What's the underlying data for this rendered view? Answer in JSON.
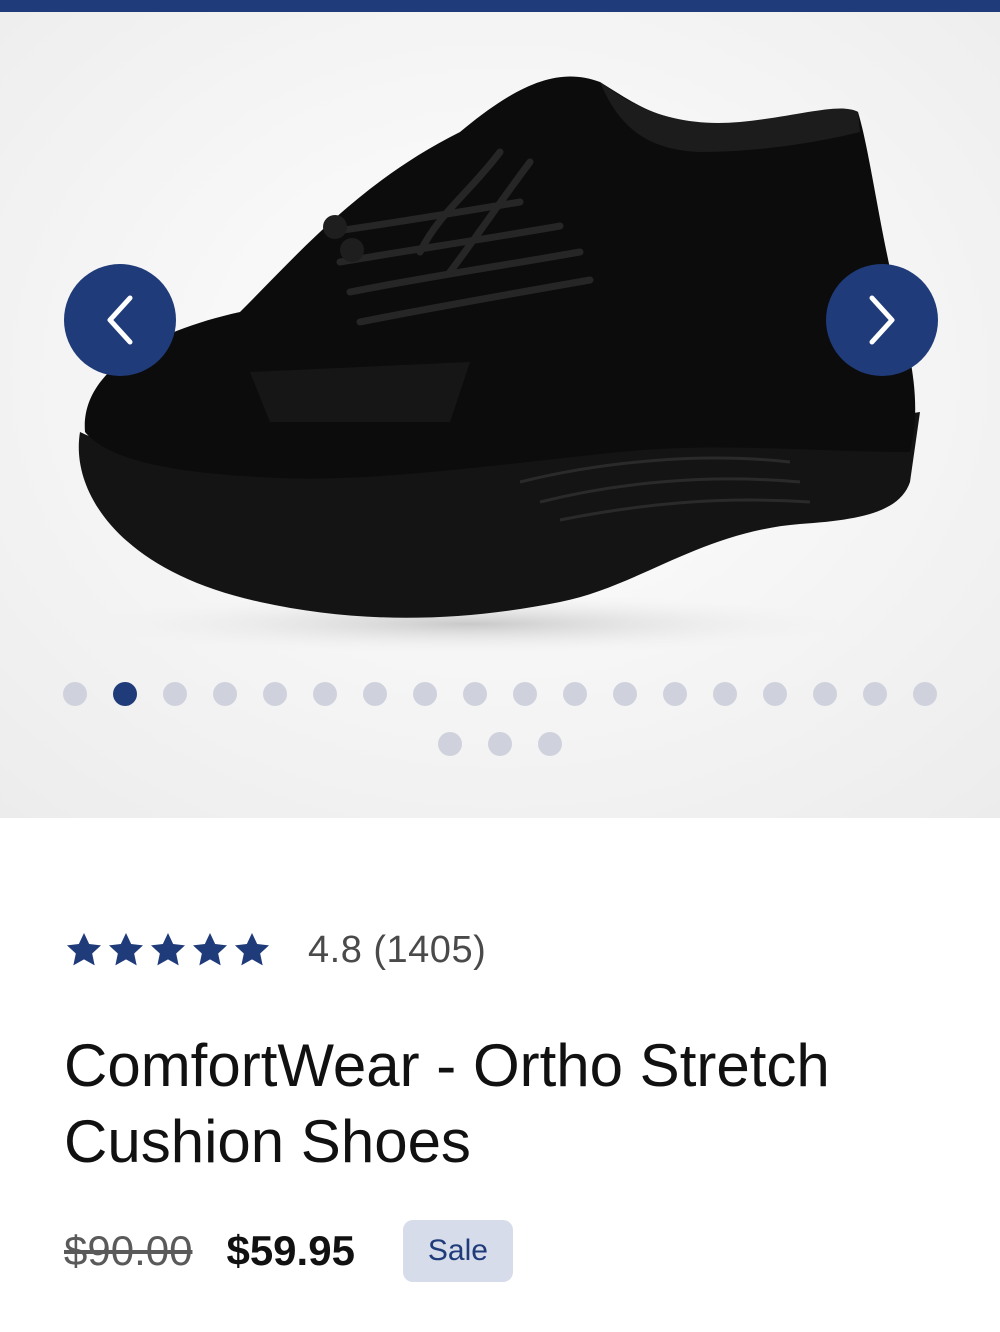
{
  "colors": {
    "brand": "#1f3b7a",
    "dot_inactive": "#cfd2dc",
    "sale_badge_bg": "#d6dcea"
  },
  "gallery": {
    "prev_icon": "chevron-left-icon",
    "next_icon": "chevron-right-icon",
    "image_count": 21,
    "active_index": 1
  },
  "product": {
    "rating_value": 4.8,
    "rating_text": "4.8 (1405)",
    "star_count": 5,
    "title": "ComfortWear - Ortho Stretch Cushion Shoes",
    "original_price": "$90.00",
    "sale_price": "$59.95",
    "badge": "Sale"
  }
}
